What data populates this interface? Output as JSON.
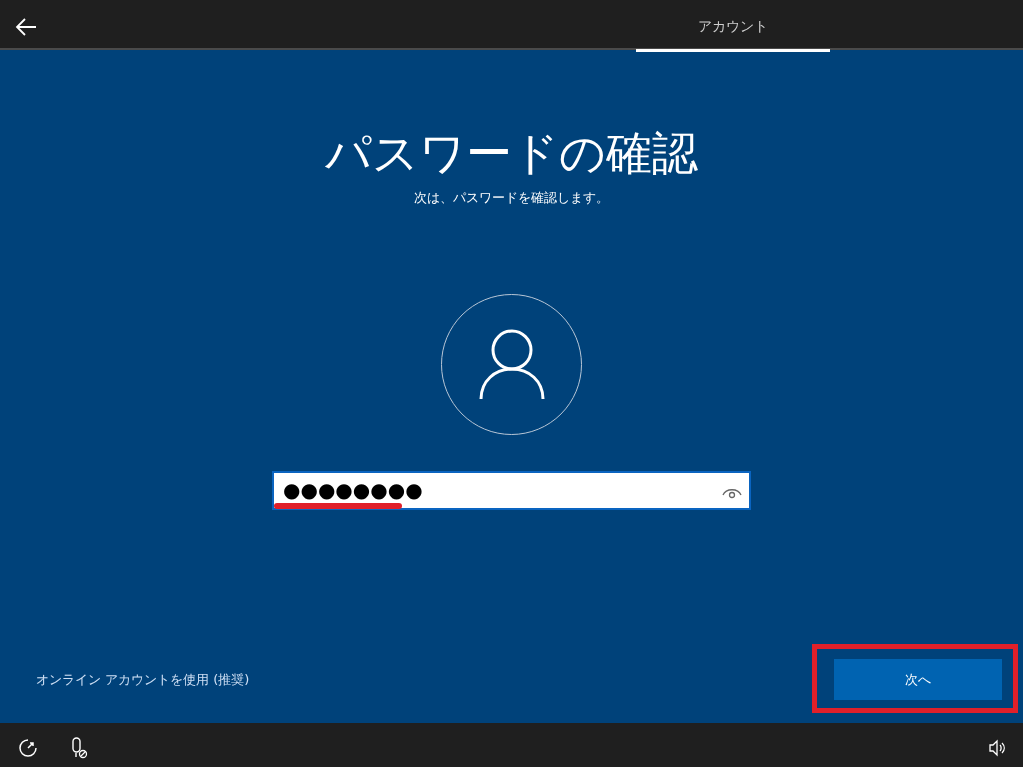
{
  "top_bar": {
    "tabs": [
      {
        "label": "アカウント",
        "selected": true
      }
    ]
  },
  "title": "パスワードの確認",
  "subtitle": "次は、パスワードを確認します。",
  "password_field": {
    "value": "●●●●●●●●"
  },
  "online_account_link": "オンライン アカウントを使用 (推奨)",
  "next_button": "次へ",
  "annotations": {
    "password_underline": true,
    "next_button_box": true
  }
}
